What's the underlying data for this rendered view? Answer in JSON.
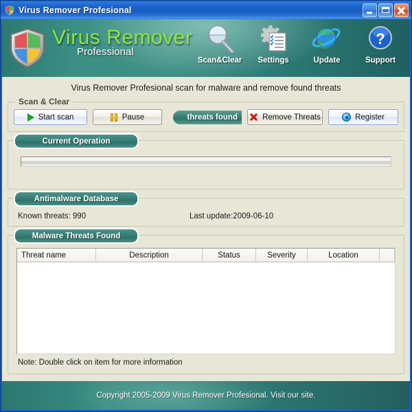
{
  "window": {
    "title": "Virus Remover Profesional",
    "icon": "shield-icon",
    "controls": {
      "minimize": "minimize-button",
      "maximize": "maximize-button",
      "close": "close-button"
    }
  },
  "banner": {
    "logo_icon": "shield-logo-icon",
    "brand_main": "Virus Remover",
    "brand_sub": "Professional",
    "tools": [
      {
        "label": "Scan&Clear",
        "icon": "magnifier-icon"
      },
      {
        "label": "Settings",
        "icon": "gear-checklist-icon"
      },
      {
        "label": "Update",
        "icon": "globe-orbit-icon"
      },
      {
        "label": "Support",
        "icon": "question-mark-icon"
      }
    ]
  },
  "subtitle": "Virus Remover Profesional scan for malware and remove found threats",
  "scan_group": {
    "title": "Scan & Clear",
    "start_label": "Start scan",
    "pause_label": "Pause",
    "threats_found_label": "threats found",
    "remove_label": "Remove Threats",
    "register_label": "Register"
  },
  "current_operation": {
    "title": "Current Operation",
    "progress_percent": 0
  },
  "database": {
    "title": "Antimalware Database",
    "known_threats": "Known threats: 990",
    "last_update": "Last update:2009-06-10"
  },
  "threats": {
    "title": "Malware Threats Found",
    "columns": [
      "Threat name",
      "Description",
      "Status",
      "Severity",
      "Location",
      ""
    ],
    "rows": [],
    "note": "Note: Double click on item for more information"
  },
  "footer": {
    "text": "Copyright 2005-2009 Virus Remover Profesional. Visit our site."
  },
  "colors": {
    "teal": "#2f756c",
    "brand_green": "#8ce63f",
    "beige": "#e8e6d7",
    "titlebar_blue": "#1d63c9"
  }
}
